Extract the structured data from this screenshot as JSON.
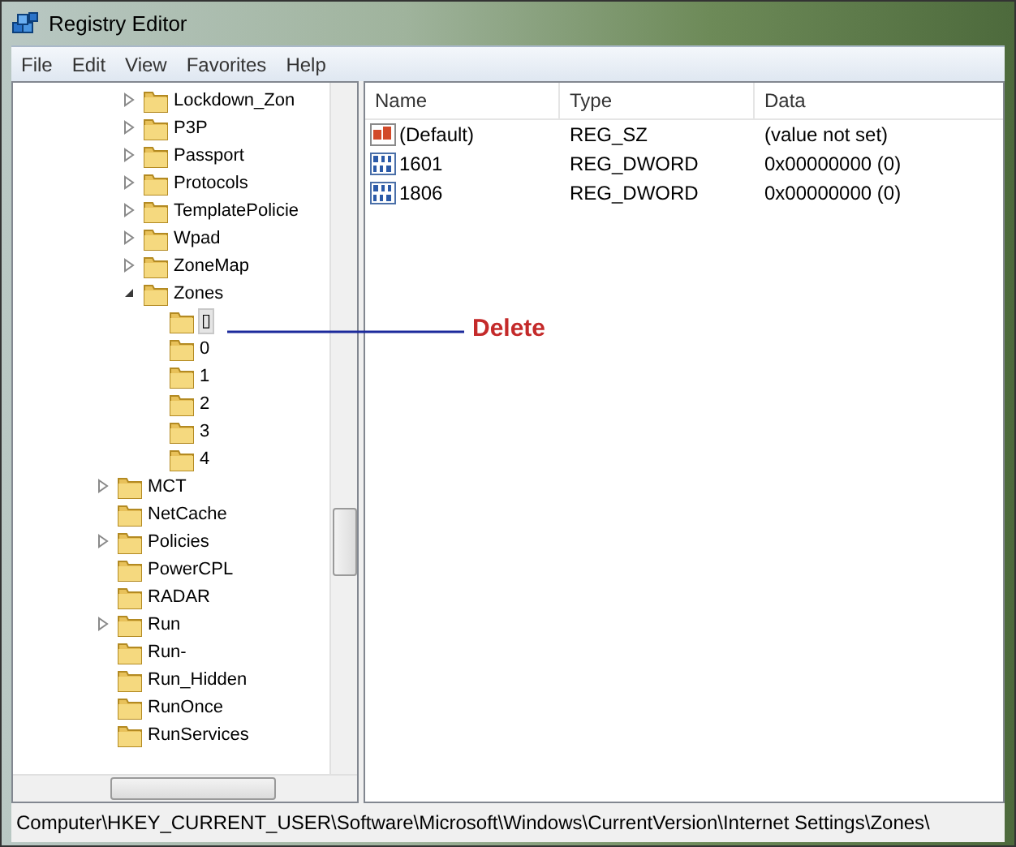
{
  "window": {
    "title": "Registry Editor"
  },
  "menu": [
    "File",
    "Edit",
    "View",
    "Favorites",
    "Help"
  ],
  "tree": {
    "scrolled_children": [
      {
        "label": "Lockdown_Zon",
        "expanded": false,
        "selected": false
      },
      {
        "label": "P3P",
        "expanded": false,
        "selected": false
      },
      {
        "label": "Passport",
        "expanded": false,
        "selected": false
      },
      {
        "label": "Protocols",
        "expanded": false,
        "selected": false
      },
      {
        "label": "TemplatePolicie",
        "expanded": false,
        "selected": false
      },
      {
        "label": "Wpad",
        "expanded": false,
        "selected": false
      },
      {
        "label": "ZoneMap",
        "expanded": false,
        "selected": false
      },
      {
        "label": "Zones",
        "expanded": true,
        "selected": false,
        "children": [
          {
            "label": "▯",
            "selected": true
          },
          {
            "label": "0",
            "selected": false
          },
          {
            "label": "1",
            "selected": false
          },
          {
            "label": "2",
            "selected": false
          },
          {
            "label": "3",
            "selected": false
          },
          {
            "label": "4",
            "selected": false
          }
        ]
      }
    ],
    "items": [
      {
        "label": "MCT",
        "expanded": false,
        "selected": false
      },
      {
        "label": "NetCache",
        "selected": false
      },
      {
        "label": "Policies",
        "expanded": false,
        "selected": false
      },
      {
        "label": "PowerCPL",
        "selected": false
      },
      {
        "label": "RADAR",
        "selected": false
      },
      {
        "label": "Run",
        "expanded": false,
        "selected": false
      },
      {
        "label": "Run-",
        "selected": false
      },
      {
        "label": "Run_Hidden",
        "selected": false
      },
      {
        "label": "RunOnce",
        "selected": false
      },
      {
        "label": "RunServices",
        "selected": false
      }
    ]
  },
  "table": {
    "columns": [
      "Name",
      "Type",
      "Data"
    ],
    "rows": [
      {
        "kind": "string",
        "name": "(Default)",
        "type": "REG_SZ",
        "data": "(value not set)"
      },
      {
        "kind": "dword",
        "name": "1601",
        "type": "REG_DWORD",
        "data": "0x00000000 (0)"
      },
      {
        "kind": "dword",
        "name": "1806",
        "type": "REG_DWORD",
        "data": "0x00000000 (0)"
      }
    ]
  },
  "annotation": {
    "label": "Delete"
  },
  "status_bar": "Computer\\HKEY_CURRENT_USER\\Software\\Microsoft\\Windows\\CurrentVersion\\Internet Settings\\Zones\\"
}
